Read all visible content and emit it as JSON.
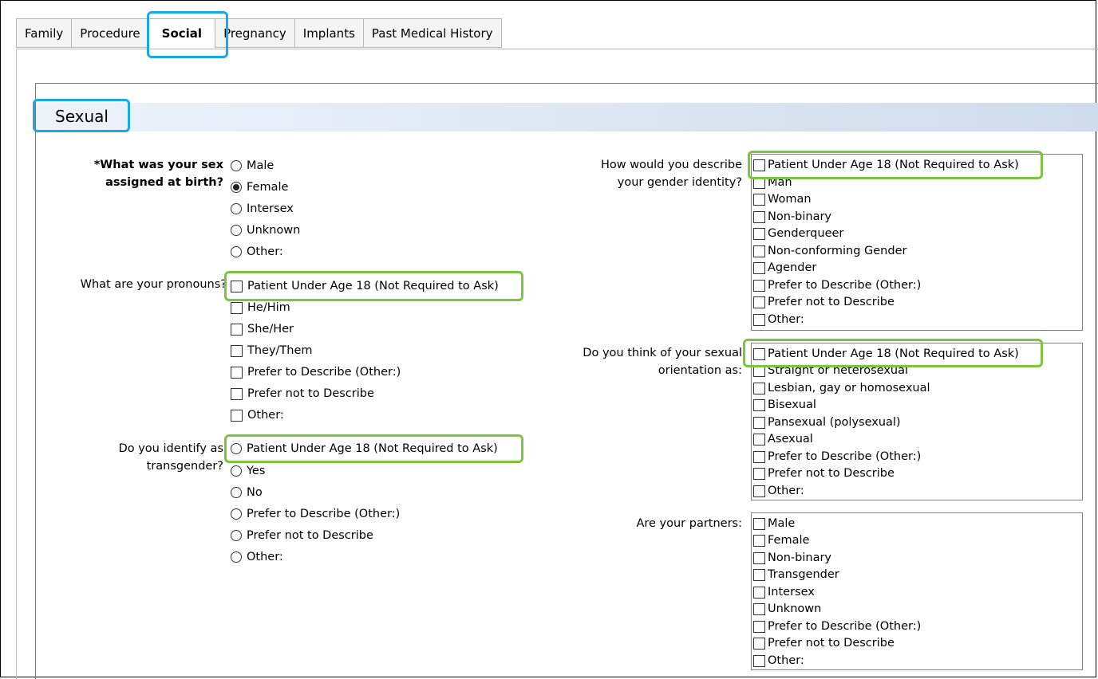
{
  "tabs": [
    {
      "label": "Family",
      "active": false
    },
    {
      "label": "Procedure",
      "active": false
    },
    {
      "label": "Social",
      "active": true
    },
    {
      "label": "Pregnancy",
      "active": false
    },
    {
      "label": "Implants",
      "active": false
    },
    {
      "label": "Past Medical History",
      "active": false
    }
  ],
  "section": {
    "title": "Sexual"
  },
  "left": {
    "sex_at_birth": {
      "label_line1": "*What was your sex",
      "label_line2": "assigned at birth?",
      "options": [
        "Male",
        "Female",
        "Intersex",
        "Unknown",
        "Other:"
      ],
      "selected": "Female"
    },
    "pronouns": {
      "label": "What are your pronouns?",
      "options": [
        "Patient Under Age 18 (Not Required to Ask)",
        "He/Him",
        "She/Her",
        "They/Them",
        "Prefer to Describe (Other:)",
        "Prefer not to Describe",
        "Other:"
      ]
    },
    "transgender": {
      "label_line1": "Do you identify as",
      "label_line2": "transgender?",
      "options": [
        "Patient Under Age 18 (Not Required to Ask)",
        "Yes",
        "No",
        "Prefer to Describe (Other:)",
        "Prefer not to Describe",
        "Other:"
      ]
    }
  },
  "right": {
    "gender_identity": {
      "label_line1": "How would you describe",
      "label_line2": "your gender identity?",
      "options": [
        "Patient Under Age 18 (Not Required to Ask)",
        "Man",
        "Woman",
        "Non-binary",
        "Genderqueer",
        "Non-conforming Gender",
        "Agender",
        "Prefer to Describe (Other:)",
        "Prefer not to Describe",
        "Other:"
      ]
    },
    "orientation": {
      "label_line1": "Do you think of your sexual",
      "label_line2": "orientation as:",
      "options": [
        "Patient Under Age 18 (Not Required to Ask)",
        "Straight or heterosexual",
        "Lesbian, gay or homosexual",
        "Bisexual",
        "Pansexual (polysexual)",
        "Asexual",
        "Prefer to Describe (Other:)",
        "Prefer not to Describe",
        "Other:"
      ]
    },
    "partners": {
      "label": "Are your partners:",
      "options": [
        "Male",
        "Female",
        "Non-binary",
        "Transgender",
        "Intersex",
        "Unknown",
        "Prefer to Describe (Other:)",
        "Prefer not to Describe",
        "Other:"
      ]
    }
  },
  "colors": {
    "highlight_blue": "#19a9e6",
    "highlight_green": "#7dc441",
    "header_band": "#dbe5f1"
  }
}
